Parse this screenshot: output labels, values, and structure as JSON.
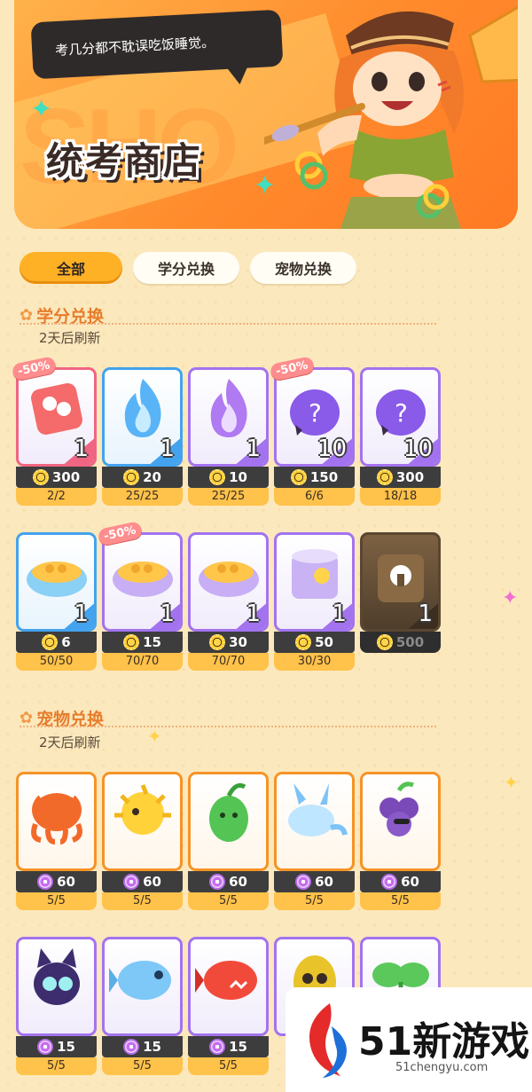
{
  "banner": {
    "speech": "考几分都不耽误吃饭睡觉。",
    "title": "统考商店"
  },
  "tabs": [
    {
      "label": "全部",
      "active": true
    },
    {
      "label": "学分兑换",
      "active": false
    },
    {
      "label": "宠物兑换",
      "active": false
    }
  ],
  "credit_section": {
    "title": "学分兑换",
    "refresh": "2天后刷新",
    "items": [
      {
        "name": "red-dice-item",
        "qty": "1",
        "price": "300",
        "stock": "2/2",
        "discount": "-50%",
        "frame": "red",
        "currency": "gear"
      },
      {
        "name": "blue-flame-item",
        "qty": "1",
        "price": "20",
        "stock": "25/25",
        "frame": "blue",
        "currency": "gear"
      },
      {
        "name": "purple-flame-item",
        "qty": "1",
        "price": "10",
        "stock": "25/25",
        "frame": "purple",
        "currency": "gear"
      },
      {
        "name": "mystery-egg-item",
        "qty": "10",
        "price": "150",
        "stock": "6/6",
        "discount": "-50%",
        "frame": "purple",
        "currency": "gear"
      },
      {
        "name": "mystery-egg-item-2",
        "qty": "10",
        "price": "300",
        "stock": "18/18",
        "frame": "purple",
        "currency": "gear"
      },
      {
        "name": "food-bowl-blue-item",
        "qty": "1",
        "price": "6",
        "stock": "50/50",
        "frame": "blue",
        "currency": "gear"
      },
      {
        "name": "food-bowl-purple-item",
        "qty": "1",
        "price": "15",
        "stock": "70/70",
        "discount": "-50%",
        "frame": "purple",
        "currency": "gear"
      },
      {
        "name": "food-bowl-purple-item-2",
        "qty": "1",
        "price": "30",
        "stock": "70/70",
        "frame": "purple",
        "currency": "gear"
      },
      {
        "name": "pet-can-item",
        "qty": "1",
        "price": "50",
        "stock": "30/30",
        "frame": "purple",
        "currency": "gear"
      },
      {
        "name": "locked-can-item",
        "qty": "1",
        "price": "500",
        "stock": "",
        "frame": "gold",
        "currency": "gear"
      }
    ]
  },
  "pet_section": {
    "title": "宠物兑换",
    "refresh": "2天后刷新",
    "items": [
      {
        "name": "octopus-pet",
        "price": "60",
        "stock": "5/5",
        "frame": "orange",
        "currency": "gem"
      },
      {
        "name": "pufferfish-pet",
        "price": "60",
        "stock": "5/5",
        "frame": "orange",
        "currency": "gem"
      },
      {
        "name": "pea-pet",
        "price": "60",
        "stock": "5/5",
        "frame": "orange",
        "currency": "gem"
      },
      {
        "name": "axolotl-pet",
        "price": "60",
        "stock": "5/5",
        "frame": "orange",
        "currency": "gem"
      },
      {
        "name": "grape-pet",
        "price": "60",
        "stock": "5/5",
        "frame": "orange",
        "currency": "gem"
      },
      {
        "name": "black-cat-pet",
        "price": "15",
        "stock": "5/5",
        "frame": "purple",
        "currency": "gem"
      },
      {
        "name": "blue-fish-pet",
        "price": "15",
        "stock": "5/5",
        "frame": "purple",
        "currency": "gem"
      },
      {
        "name": "red-fish-pet",
        "price": "15",
        "stock": "5/5",
        "frame": "purple",
        "currency": "gem"
      },
      {
        "name": "egg-pet",
        "price": "",
        "stock": "",
        "frame": "purple",
        "currency": "gem"
      },
      {
        "name": "leaf-pet",
        "price": "",
        "stock": "",
        "frame": "purple",
        "currency": "gem"
      }
    ]
  },
  "watermark": {
    "brand": "51新游戏",
    "url": "51chengyu.com"
  },
  "colors": {
    "background": "#fbe8bd",
    "accent": "#ffb126",
    "section_title": "#e77d2c"
  }
}
